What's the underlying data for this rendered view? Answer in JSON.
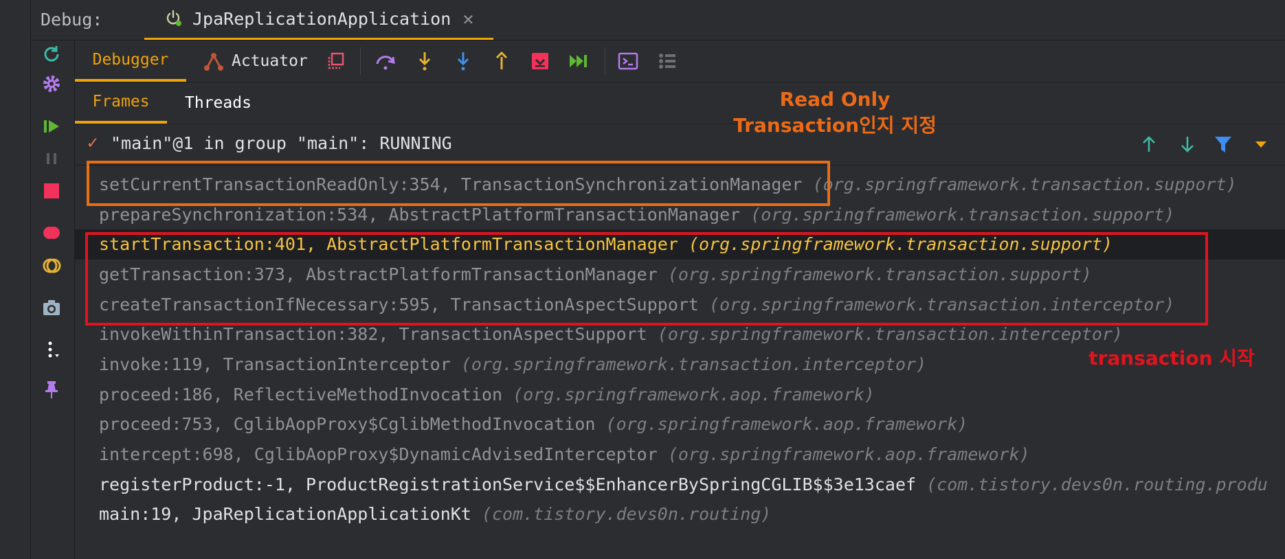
{
  "window": {
    "debug_label": "Debug:",
    "tab_title": "JpaReplicationApplication",
    "close_glyph": "×"
  },
  "sidebar_icons": [
    "rerun-icon",
    "settings-gear-icon",
    "resume-icon",
    "pause-icon",
    "stop-icon",
    "view-breakpoints-icon",
    "mute-breakpoints-icon",
    "camera-icon",
    "more-icon",
    "pin-icon"
  ],
  "toolbar": {
    "debugger_tab": "Debugger",
    "actuator_tab": "Actuator"
  },
  "subtabs": {
    "frames": "Frames",
    "threads": "Threads"
  },
  "thread": {
    "status_check": "✓",
    "text": "\"main\"@1 in group \"main\": RUNNING"
  },
  "frames": [
    {
      "method": "setCurrentTransactionReadOnly:354, TransactionSynchronizationManager",
      "pkg": "(org.springframework.transaction.support)"
    },
    {
      "method": "prepareSynchronization:534, AbstractPlatformTransactionManager",
      "pkg": "(org.springframework.transaction.support)"
    },
    {
      "method": "startTransaction:401, AbstractPlatformTransactionManager",
      "pkg": "(org.springframework.transaction.support)"
    },
    {
      "method": "getTransaction:373, AbstractPlatformTransactionManager",
      "pkg": "(org.springframework.transaction.support)"
    },
    {
      "method": "createTransactionIfNecessary:595, TransactionAspectSupport",
      "pkg": "(org.springframework.transaction.interceptor)"
    },
    {
      "method": "invokeWithinTransaction:382, TransactionAspectSupport",
      "pkg": "(org.springframework.transaction.interceptor)"
    },
    {
      "method": "invoke:119, TransactionInterceptor",
      "pkg": "(org.springframework.transaction.interceptor)"
    },
    {
      "method": "proceed:186, ReflectiveMethodInvocation",
      "pkg": "(org.springframework.aop.framework)"
    },
    {
      "method": "proceed:753, CglibAopProxy$CglibMethodInvocation",
      "pkg": "(org.springframework.aop.framework)"
    },
    {
      "method": "intercept:698, CglibAopProxy$DynamicAdvisedInterceptor",
      "pkg": "(org.springframework.aop.framework)"
    },
    {
      "method": "registerProduct:-1, ProductRegistrationService$$EnhancerBySpringCGLIB$$3e13caef",
      "pkg": "(com.tistory.devs0n.routing.produ"
    },
    {
      "method": "main:19, JpaReplicationApplicationKt",
      "pkg": "(com.tistory.devs0n.routing)"
    }
  ],
  "annotations": {
    "read_only_line1": "Read Only",
    "read_only_line2": "Transaction인지 지정",
    "transaction_start": "transaction 시작"
  },
  "colors": {
    "accent": "#f0a30a",
    "annotation_orange": "#e96d19",
    "annotation_red": "#e0141e",
    "current_frame": "#f6c342"
  }
}
